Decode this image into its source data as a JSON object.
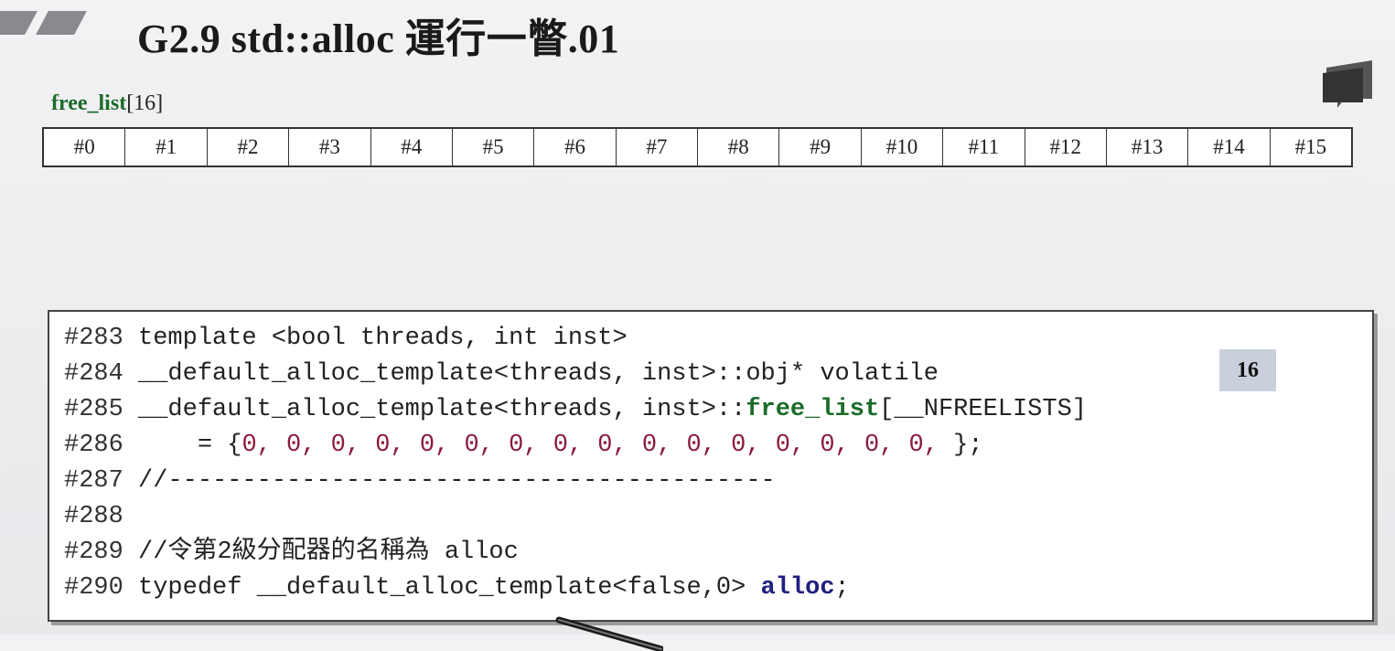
{
  "title": "G2.9 std::alloc 運行一瞥.01",
  "free_list_label": {
    "name": "free_list",
    "size": "[16]"
  },
  "slots": [
    "#0",
    "#1",
    "#2",
    "#3",
    "#4",
    "#5",
    "#6",
    "#7",
    "#8",
    "#9",
    "#10",
    "#11",
    "#12",
    "#13",
    "#14",
    "#15"
  ],
  "badge": "16",
  "code": {
    "l283": {
      "num": "#283",
      "text": " template <bool threads, int inst>"
    },
    "l284": {
      "num": "#284",
      "text": " __default_alloc_template<threads, inst>::obj* volatile"
    },
    "l285": {
      "num": "#285",
      "pre": " __default_alloc_template<threads, inst>::",
      "hl": "free_list",
      "post": "[__NFREELISTS]"
    },
    "l286": {
      "num": "#286",
      "pre": "     = {",
      "zeros": "0, 0, 0, 0, 0, 0, 0, 0, 0, 0, 0, 0, 0, 0, 0, 0,",
      "post": " };"
    },
    "l287": {
      "num": "#287",
      "text": " //-----------------------------------------"
    },
    "l288": {
      "num": "#288",
      "text": ""
    },
    "l289": {
      "num": "#289",
      "text": " //令第2級分配器的名稱為 alloc"
    },
    "l290": {
      "num": "#290",
      "pre": " typedef __default_alloc_template<false,0> ",
      "hl": "alloc",
      "post": ";"
    }
  }
}
